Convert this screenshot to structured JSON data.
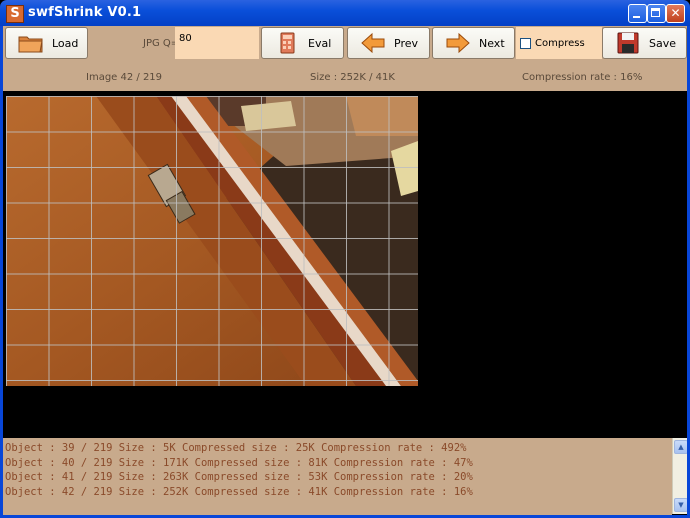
{
  "window": {
    "title": "swfShrink V0.1",
    "app_icon_letter": "S"
  },
  "toolbar": {
    "load_label": "Load",
    "jpg_label": "JPG Q=",
    "jpg_value": "80",
    "eval_label": "Eval",
    "prev_label": "Prev",
    "next_label": "Next",
    "compress_label": "Compress",
    "compress_checked": false,
    "save_label": "Save"
  },
  "info": {
    "image": "Image 42 / 219",
    "size": "Size : 252K / 41K",
    "compression": "Compression rate : 16%"
  },
  "log": [
    "Object : 39 / 219 Size : 5K Compressed size : 25K Compression rate : 492%",
    "Object : 40 / 219 Size : 171K Compressed size : 81K Compression rate : 47%",
    "Object : 41 / 219 Size : 263K Compressed size : 53K Compression rate : 20%",
    "Object : 42 / 219 Size : 252K Compressed size : 41K Compression rate : 16%"
  ],
  "colors": {
    "titlebar": "#0a4fd9",
    "panel": "#c8aa8c",
    "input_bg": "#fad9b4",
    "log_text": "#8a4a2a"
  }
}
